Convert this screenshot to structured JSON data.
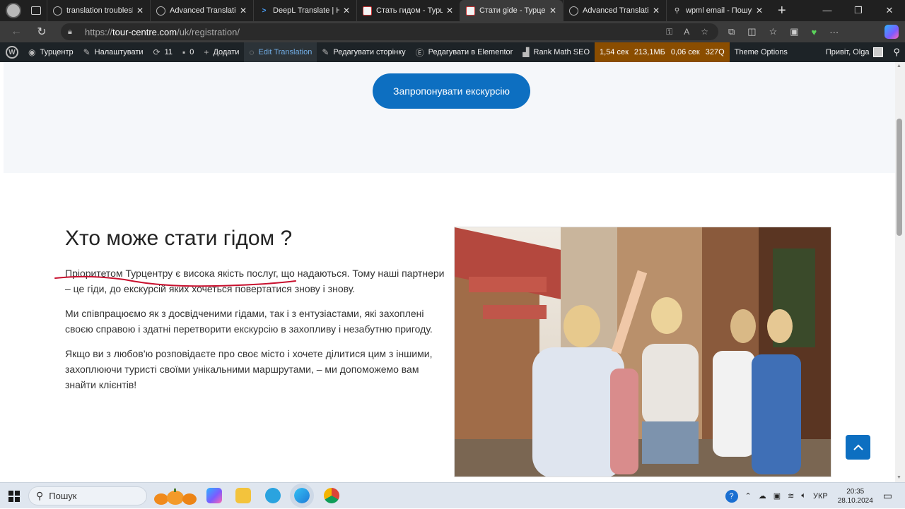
{
  "browser": {
    "tabs": [
      {
        "title": "translation troubleshoo",
        "icon": "wpml-icon"
      },
      {
        "title": "Advanced Translation",
        "icon": "wpml-icon"
      },
      {
        "title": "DeepL Translate | Най",
        "icon": "deepl-icon"
      },
      {
        "title": "Стать гидом - Турцен",
        "icon": "site-icon"
      },
      {
        "title": "Стати gide - Турцентр",
        "icon": "site-icon"
      },
      {
        "title": "Advanced Translation",
        "icon": "wpml-icon"
      },
      {
        "title": "wpml email - Пошук",
        "icon": "search-icon"
      }
    ],
    "url_prefix": "https://",
    "url_host": "tour-centre.com",
    "url_path": "/uk/registration/"
  },
  "wpbar": {
    "site": "Турцентр",
    "customize": "Налаштувати",
    "updates": "11",
    "comments": "0",
    "add_new": "Додати",
    "edit_translation": "Edit Translation",
    "edit_page": "Редагувати сторінку",
    "elementor": "Редагувати в Elementor",
    "rank_math": "Rank Math SEO",
    "qm_time": "1,54 сек",
    "qm_mem": "213,1МБ",
    "qm_db": "0,06 сек",
    "qm_queries": "327Q",
    "theme_options": "Theme Options",
    "greeting": "Привіт, Olga"
  },
  "page": {
    "cta_button": "Запропонувати екскурсію",
    "heading": "Хто може стати гідом ?",
    "paragraphs": [
      "Пріоритетом Турцентру є висока якість послуг, що надаються. Тому наші партнери – це гіди, до екскурсій яких хочеться повертатися знову і знову.",
      "Ми співпрацюємо як з досвідченими гідами, так і з ентузіастами, які захоплені своєю справою і здатні перетворити екскурсію в захопливу і незабутню пригоду.",
      "Якщо ви з любов’ю розповідаєте про своє місто і хочете ділитися цим з іншими, захоплюючи туристі своїми унікальними маршрутами, – ми допоможемо вам знайти клієнтів!"
    ]
  },
  "taskbar": {
    "search_placeholder": "Пошук",
    "language": "УКР",
    "time": "20:35",
    "date": "28.10.2024"
  },
  "colors": {
    "accent": "#0d6fc1",
    "wp_bar": "#1d2327",
    "query_monitor": "#8a4d00"
  }
}
